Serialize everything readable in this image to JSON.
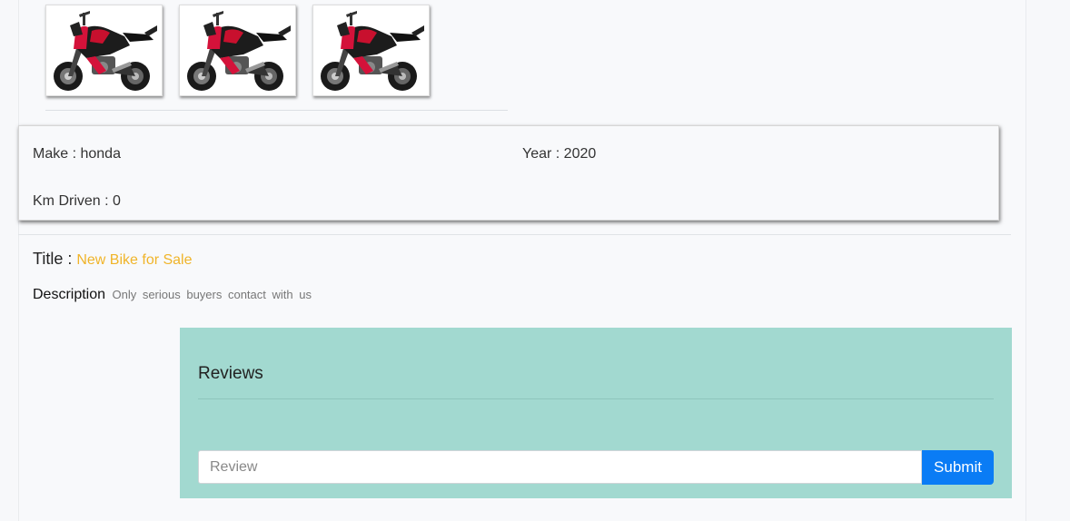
{
  "gallery": {
    "images": [
      {
        "alt": "motorcycle-photo"
      },
      {
        "alt": "motorcycle-photo"
      },
      {
        "alt": "motorcycle-photo"
      }
    ]
  },
  "specs": {
    "make_label": "Make : ",
    "make_value": "honda",
    "year_label": "Year : ",
    "year_value": "2020",
    "km_label": "Km Driven : ",
    "km_value": "0"
  },
  "listing": {
    "title_label": "Title : ",
    "title_value": "New Bike for Sale",
    "description_label": "Description",
    "description_value": "Only serious buyers contact with us"
  },
  "reviews": {
    "heading": "Reviews",
    "input_placeholder": "Review",
    "submit_label": "Submit"
  },
  "colors": {
    "reviews_bg": "#a2d9d0",
    "title_accent": "#f0b429",
    "submit_bg": "#0a7cf5"
  }
}
